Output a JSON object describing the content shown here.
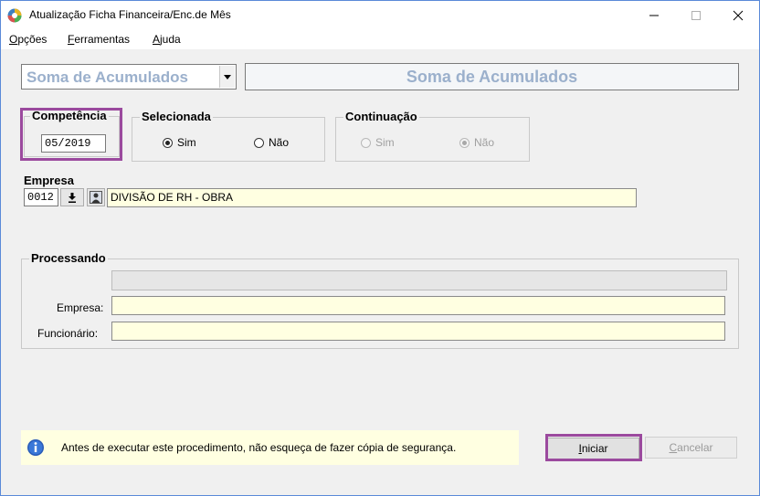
{
  "window": {
    "title": "Atualização Ficha Financeira/Enc.de Mês",
    "minimize_glyph": "—",
    "maximize_glyph": "☐",
    "close_glyph": "✕"
  },
  "menu": {
    "items": [
      {
        "hotkey": "O",
        "rest": "pções"
      },
      {
        "hotkey": "F",
        "rest": "erramentas"
      },
      {
        "hotkey": "A",
        "rest": "juda"
      }
    ]
  },
  "procedure": {
    "selected": "Soma de Acumulados",
    "header_title": "Soma de Acumulados"
  },
  "competencia": {
    "legend": "Competência",
    "value": "05/2019"
  },
  "selecionada": {
    "legend": "Selecionada",
    "options": [
      {
        "label": "Sim",
        "checked": true
      },
      {
        "label": "Não",
        "checked": false
      }
    ]
  },
  "continuacao": {
    "legend": "Continuação",
    "options": [
      {
        "label": "Sim",
        "checked": false
      },
      {
        "label": "Não",
        "checked": true
      }
    ]
  },
  "empresa": {
    "label": "Empresa",
    "code": "0012",
    "name": "DIVISÃO DE RH - OBRA"
  },
  "processando": {
    "legend": "Processando",
    "progress_percent": 0,
    "empresa_label": "Empresa:",
    "empresa_value": "",
    "funcionario_label": "Funcionário:",
    "funcionario_value": ""
  },
  "info": {
    "message": "Antes de executar este procedimento, não esqueça de fazer cópia de segurança."
  },
  "buttons": {
    "iniciar": {
      "hotkey": "I",
      "rest": "niciar"
    },
    "cancelar": {
      "hotkey": "C",
      "rest": "ancelar"
    }
  },
  "colors": {
    "highlight": "#9b4a9e",
    "field_yellow": "#ffffe1",
    "header_text": "#9bb0cc"
  },
  "icons": {
    "app": "app-globe-icon",
    "combo_arrow": "chevron-down-icon",
    "download": "download-arrow-icon",
    "lookup": "person-lookup-icon",
    "info": "info-icon"
  }
}
